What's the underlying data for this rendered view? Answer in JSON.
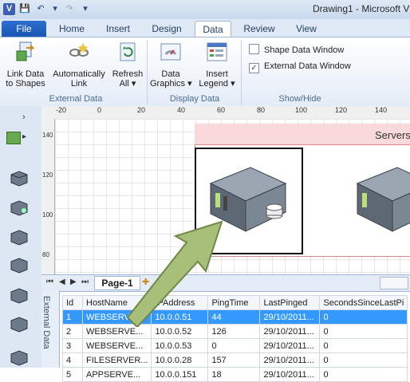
{
  "window": {
    "title": "Drawing1 - Microsoft V",
    "app_icon": "V"
  },
  "qat": {
    "save": "💾",
    "undo": "↶",
    "redo": "↷",
    "more": "▾"
  },
  "tabs": {
    "file": "File",
    "home": "Home",
    "insert": "Insert",
    "design": "Design",
    "data": "Data",
    "review": "Review",
    "view": "View"
  },
  "ribbon": {
    "link_data": "Link Data\nto Shapes",
    "auto_link": "Automatically\nLink",
    "refresh_all": "Refresh\nAll ▾",
    "data_graphics": "Data\nGraphics ▾",
    "insert_legend": "Insert\nLegend ▾",
    "shape_data_window": "Shape Data Window",
    "external_data_window": "External Data Window",
    "group_external": "External Data",
    "group_display": "Display Data",
    "group_showhide": "Show/Hide"
  },
  "ruler": {
    "ticks": [
      "-20",
      "0",
      "20",
      "40",
      "60",
      "80",
      "100",
      "120",
      "140"
    ]
  },
  "vruler": {
    "ticks": [
      "140",
      "120",
      "100",
      "80"
    ]
  },
  "canvas": {
    "container_title": "Servers"
  },
  "pages": {
    "page1": "Page-1"
  },
  "external_data": {
    "panel_label": "External Data",
    "columns": [
      "Id",
      "HostName",
      "IPAddress",
      "PingTime",
      "LastPinged",
      "SecondsSinceLastPi"
    ],
    "rows": [
      {
        "id": "1",
        "host": "WEBSERVE...",
        "ip": "10.0.0.51",
        "ping": "44",
        "last": "29/10/2011...",
        "secs": "0"
      },
      {
        "id": "2",
        "host": "WEBSERVE...",
        "ip": "10.0.0.52",
        "ping": "126",
        "last": "29/10/2011...",
        "secs": "0"
      },
      {
        "id": "3",
        "host": "WEBSERVE...",
        "ip": "10.0.0.53",
        "ping": "0",
        "last": "29/10/2011...",
        "secs": "0"
      },
      {
        "id": "4",
        "host": "FILESERVER...",
        "ip": "10.0.0.28",
        "ping": "157",
        "last": "29/10/2011...",
        "secs": "0"
      },
      {
        "id": "5",
        "host": "APPSERVE...",
        "ip": "10.0.0.151",
        "ping": "18",
        "last": "29/10/2011...",
        "secs": "0"
      }
    ]
  },
  "colors": {
    "accent": "#2d6fcf",
    "selection": "#3399ff",
    "arrow": "#a8bf7a"
  }
}
